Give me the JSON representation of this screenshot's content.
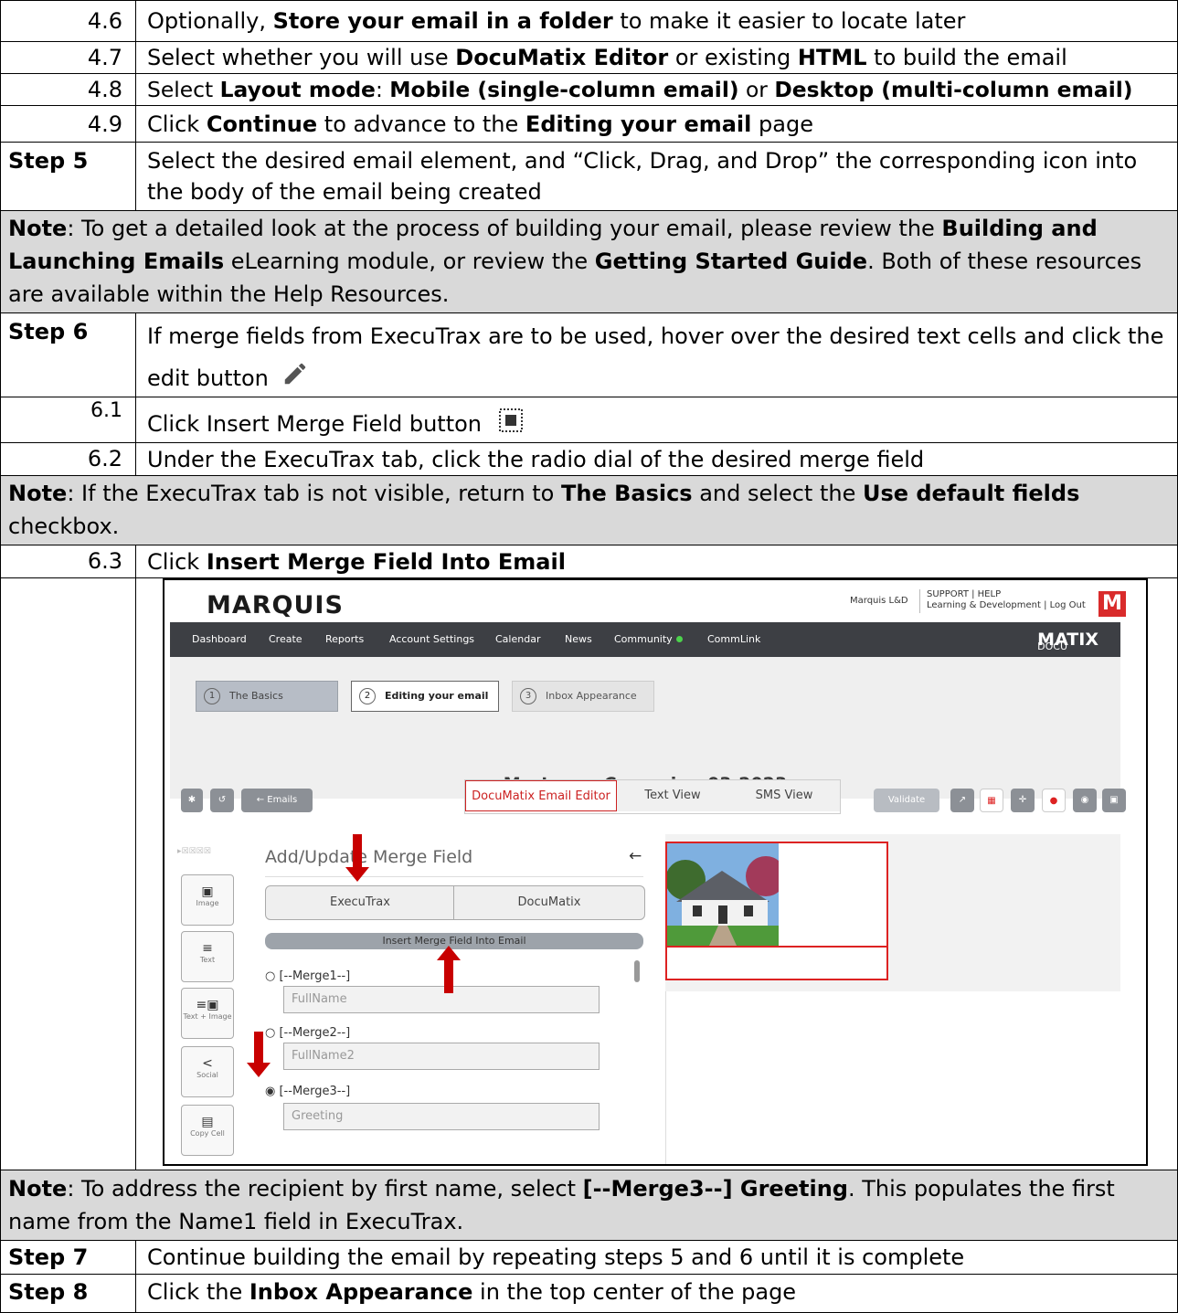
{
  "rows": {
    "r46": {
      "num": "4.6",
      "a": "Optionally, ",
      "b": "Store your email in a folder",
      "c": " to make it easier to locate later"
    },
    "r47": {
      "num": "4.7",
      "a": "Select whether you will use ",
      "b": "DocuMatix Editor",
      "c": " or existing ",
      "d": "HTML",
      "e": " to build the email"
    },
    "r48": {
      "num": "4.8",
      "a": "Select ",
      "b": "Layout mode",
      "c": ": ",
      "d": "Mobile (single-column email)",
      "e": " or ",
      "f": "Desktop (multi-column email)"
    },
    "r49": {
      "num": "4.9",
      "a": "Click ",
      "b": "Continue",
      "c": " to advance to the ",
      "d": "Editing your email",
      "e": " page"
    },
    "step5": {
      "label": "Step 5",
      "text": "Select the desired email element, and “Click, Drag, and Drop” the corresponding icon into the body of the email being created"
    },
    "note1": {
      "a": "Note",
      "b": ": To get a detailed look at the process of building your email, please review the ",
      "c": "Building and Launching Emails",
      "d": " eLearning module, or review the ",
      "e": "Getting Started Guide",
      "f": ". Both of these resources are available within the Help Resources."
    },
    "step6": {
      "label": "Step 6",
      "text": "If merge fields from ExecuTrax are to be used, hover over the desired text cells and click the edit button"
    },
    "r61": {
      "num": "6.1",
      "text": "Click Insert Merge Field button"
    },
    "r62": {
      "num": "6.2",
      "text": "Under the ExecuTrax tab, click the radio dial of the desired merge field"
    },
    "note2": {
      "a": "Note",
      "b": ": If the ExecuTrax tab is not visible, return to ",
      "c": "The Basics",
      "d": " and select the ",
      "e": "Use default fields",
      "f": " checkbox."
    },
    "r63": {
      "num": "6.3",
      "a": "Click ",
      "b": "Insert Merge Field Into Email"
    },
    "note3": {
      "a": "Note",
      "b": ": To address the recipient by first name, select ",
      "c": "[--Merge3--] Greeting",
      "d": ". This populates the first name from the Name1 field in ExecuTrax."
    },
    "step7": {
      "label": "Step 7",
      "text": "Continue building the email by repeating steps 5 and 6 until it is complete"
    },
    "step8": {
      "label": "Step 8",
      "a": "Click the ",
      "b": "Inbox Appearance",
      "c": " in the top center of the page"
    }
  },
  "app": {
    "logo": "MARQUIS",
    "account": "Marquis L&D",
    "support_line1": "SUPPORT | HELP",
    "support_line2": "Learning & Development | Log Out",
    "mlogo": "M",
    "nav": [
      "Dashboard",
      "Create",
      "Reports",
      "Account Settings",
      "Calendar",
      "News",
      "Community",
      "CommLink"
    ],
    "brand_a": "DOCU",
    "brand_b": "MATIX",
    "steps": [
      {
        "num": "1",
        "label": "The Basics"
      },
      {
        "num": "2",
        "label": "Editing your email"
      },
      {
        "num": "3",
        "label": "Inbox Appearance"
      }
    ],
    "campaign_title": "Mortgage Campaign 03-2023",
    "emails_btn": "← Emails",
    "tabs": [
      "DocuMatix Email Editor",
      "Text View",
      "SMS View"
    ],
    "validate": "Validate",
    "panel_title": "Add/Update Merge Field",
    "panel_back": "←",
    "panel_tabs": [
      "ExecuTrax",
      "DocuMatix"
    ],
    "insert_btn": "Insert Merge Field Into Email",
    "merges": [
      {
        "label": "[--Merge1--]",
        "value": "FullName"
      },
      {
        "label": "[--Merge2--]",
        "value": "FullName2"
      },
      {
        "label": "[--Merge3--]",
        "value": "Greeting"
      }
    ],
    "side": [
      "Image",
      "Text",
      "Text + Image",
      "Social",
      "Copy Cell"
    ]
  }
}
